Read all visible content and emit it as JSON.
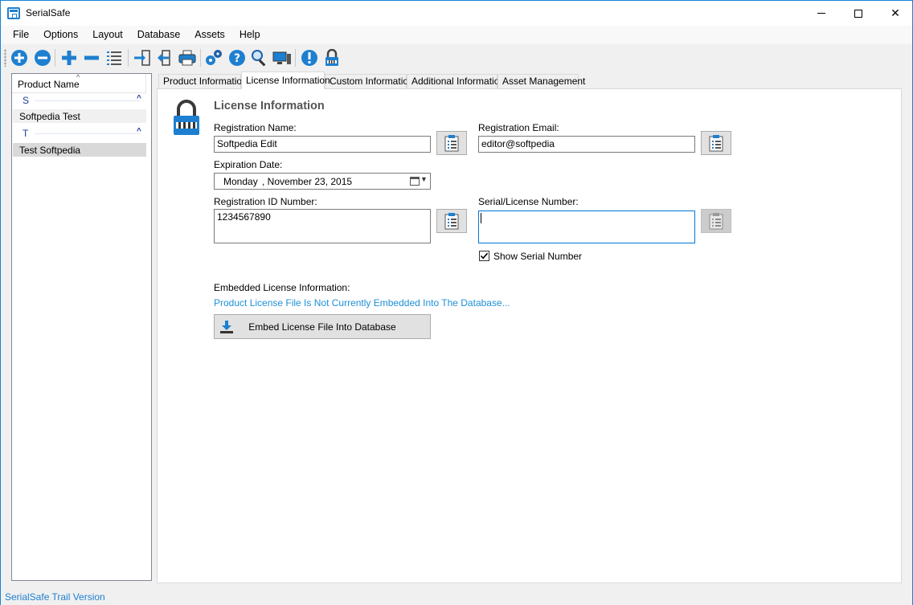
{
  "window": {
    "title": "SerialSafe",
    "minimize_label": "—",
    "close_label": "✕"
  },
  "menu": [
    "File",
    "Options",
    "Layout",
    "Database",
    "Assets",
    "Help"
  ],
  "toolbar": {
    "icons": [
      "add-circle-icon",
      "remove-circle-icon",
      "add-icon",
      "remove-icon",
      "list-icon",
      "import-icon",
      "export-icon",
      "print-icon",
      "settings-gears-icon",
      "help-icon",
      "search-icon",
      "computer-icon",
      "info-icon",
      "lock-icon"
    ]
  },
  "product_list": {
    "header": "Product Name",
    "sort_indicator": "^",
    "groups": [
      {
        "letter": "S",
        "items": [
          "Softpedia Test"
        ]
      },
      {
        "letter": "T",
        "items": [
          "Test Softpedia"
        ]
      }
    ],
    "collapse_glyph": "^",
    "selected_item": "Test Softpedia"
  },
  "tabs": [
    "Product Information",
    "License Information",
    "Custom Information",
    "Additional Information",
    "Asset Management"
  ],
  "active_tab": "License Information",
  "license": {
    "section_title": "License Information",
    "registration_name_label": "Registration Name:",
    "registration_name_value": "Softpedia Edit",
    "registration_email_label": "Registration Email:",
    "registration_email_value": "editor@softpedia",
    "expiration_date_label": "Expiration Date:",
    "expiration_dow": "Monday",
    "expiration_rest": ", November 23, 2015",
    "registration_id_label": "Registration ID Number:",
    "registration_id_value": "1234567890",
    "serial_label": "Serial/License Number:",
    "serial_value": "",
    "show_serial_label": "Show Serial Number",
    "show_serial_checked": true,
    "embedded_label": "Embedded License Information:",
    "embedded_status": "Product License File Is Not Currently Embedded Into The Database...",
    "embed_button_label": "Embed License File Into Database"
  },
  "status": {
    "text": "SerialSafe Trail Version"
  },
  "colors": {
    "accent": "#1e7fd0",
    "link": "#1e90d8",
    "group_text": "#1e3c96"
  }
}
